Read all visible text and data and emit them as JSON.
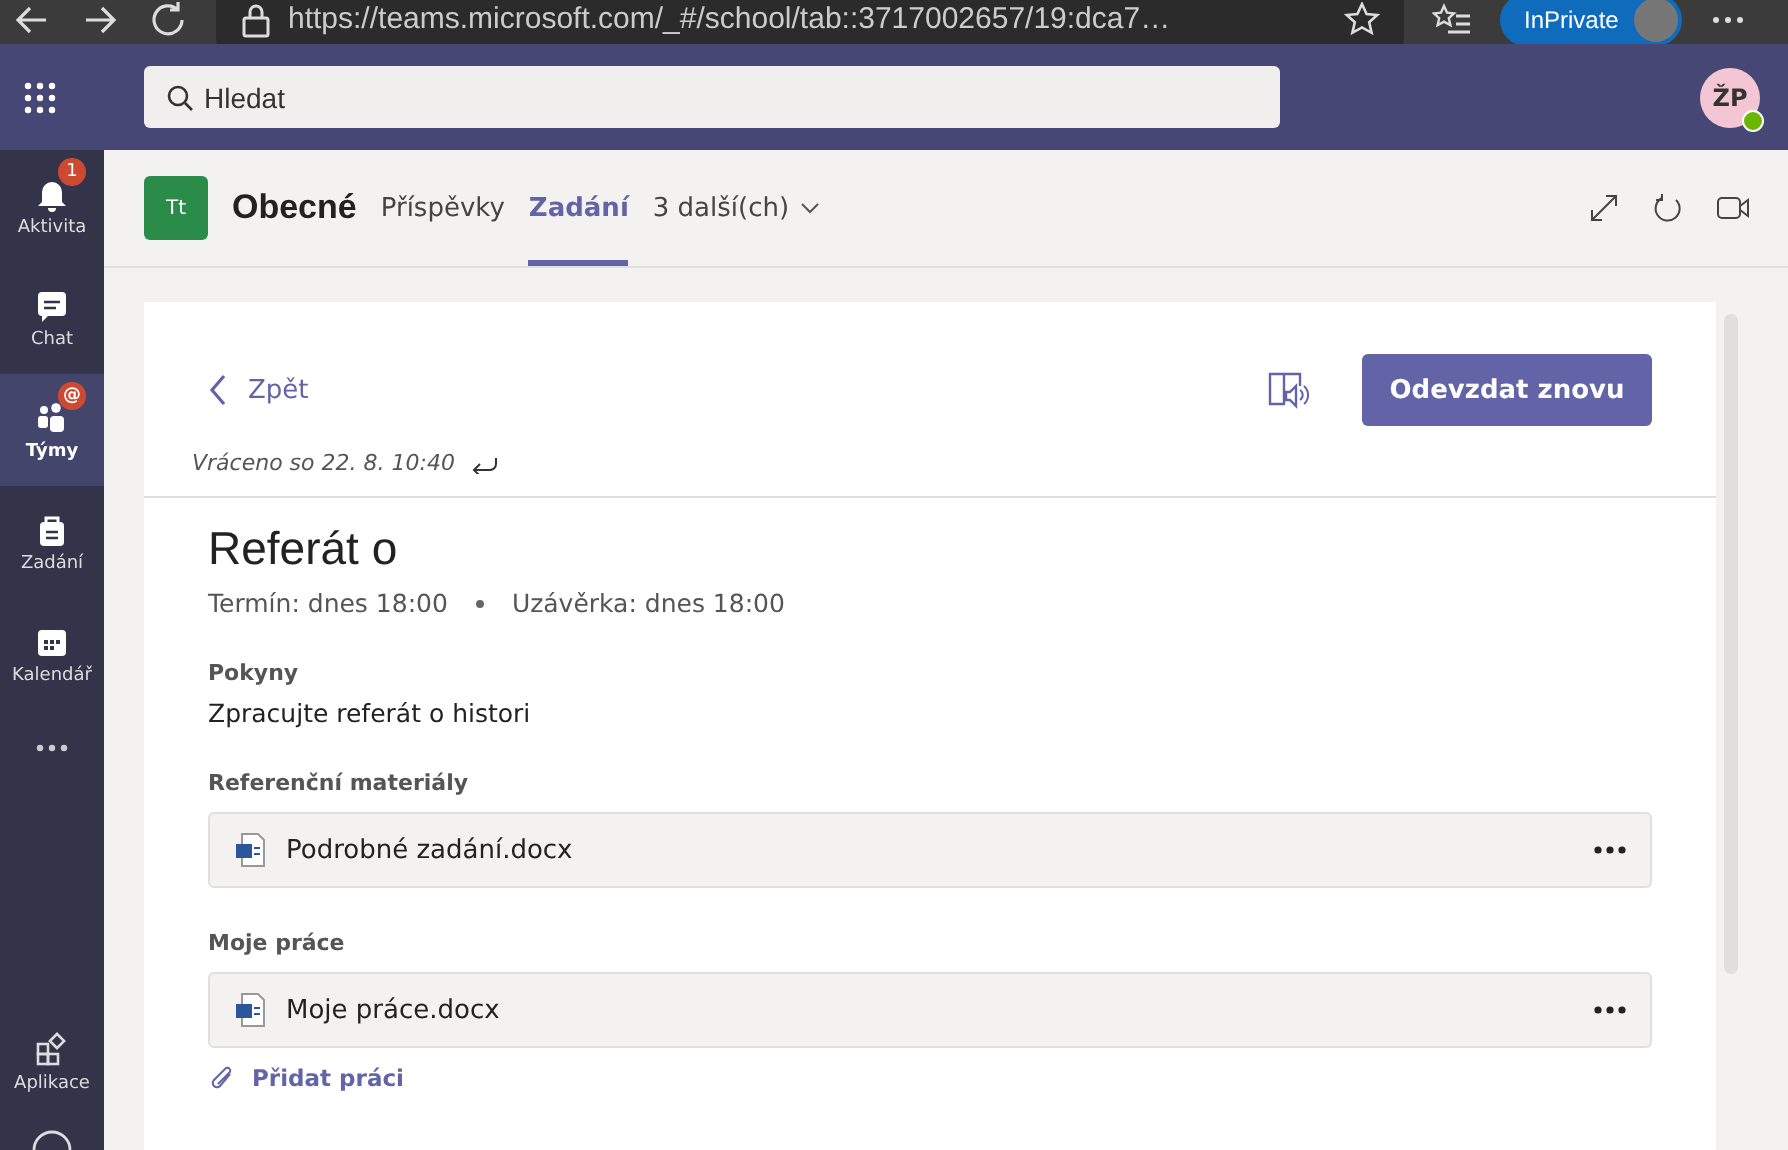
{
  "browser": {
    "url": "https://teams.microsoft.com/_#/school/tab::3717002657/19:dca7…",
    "inprivate": "InPrivate"
  },
  "topbar": {
    "search": {
      "placeholder": "Hledat"
    },
    "avatar": "ŽP"
  },
  "rail": [
    {
      "kind": "bell",
      "label": "Aktivita",
      "selected": false,
      "badge": "1"
    },
    {
      "kind": "chat",
      "label": "Chat",
      "selected": false
    },
    {
      "kind": "teams",
      "label": "Týmy",
      "selected": true,
      "badge": "@"
    },
    {
      "kind": "bag",
      "label": "Zadání",
      "selected": false
    },
    {
      "kind": "calendar",
      "label": "Kalendář",
      "selected": false
    },
    {
      "kind": "more",
      "selected": false
    },
    {
      "kind": "apps",
      "label": "Aplikace",
      "selected": false
    }
  ],
  "channel": {
    "team_initials": "Tt",
    "name": "Obecné",
    "tabs": [
      {
        "label": "Příspěvky",
        "selected": false
      },
      {
        "label": "Zadání",
        "selected": true
      },
      {
        "label": "3 další(ch)",
        "selected": false
      }
    ]
  },
  "assignment": {
    "back": "Zpět",
    "submit": "Odevzdat znovu",
    "returned": "Vráceno so 22. 8. 10:40",
    "title": "Referát o",
    "due": "Termín: dnes 18:00",
    "close": "Uzávěrka: dnes 18:00",
    "instructions_label": "Pokyny",
    "instructions": "Zpracujte referát o histori",
    "sections": [
      {
        "label": "Referenční materiály",
        "files": [
          "Podrobné zadání.docx"
        ]
      },
      {
        "label": "Moje práce",
        "files": [
          "Moje práce.docx"
        ]
      }
    ],
    "add_work": "Přidat práci"
  }
}
